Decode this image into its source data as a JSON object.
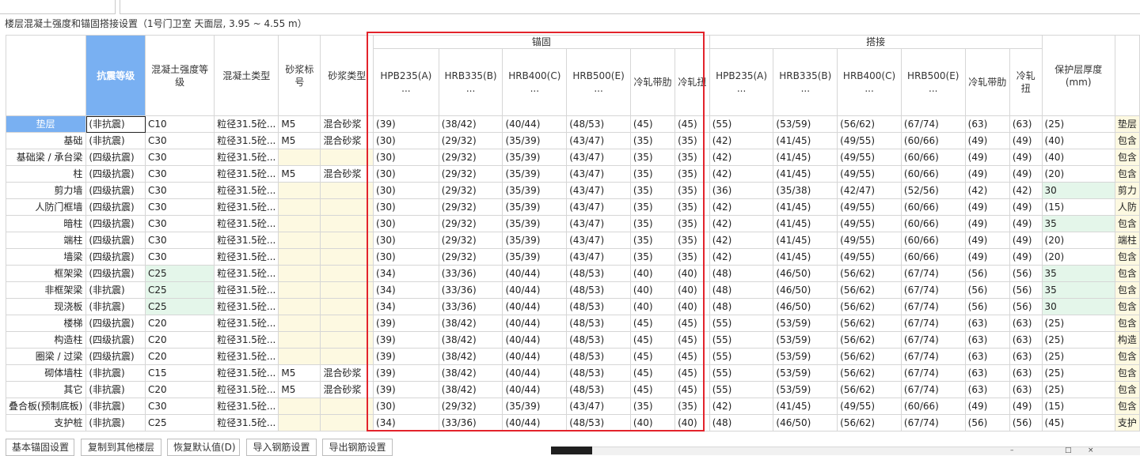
{
  "info_text": "楼层混凝土强度和锚固搭接设置（1号门卫室  天面层, 3.95 ~ 4.55 m）",
  "groups": {
    "anchor": "锚固",
    "lap": "搭接"
  },
  "headers": {
    "seismic": "抗震等级",
    "concrete_grade": "混凝土强度等级",
    "concrete_type": "混凝土类型",
    "mortar_grade": "砂浆标号",
    "mortar_type": "砂浆类型",
    "rebar": [
      "HPB235(A)",
      "HRB335(B)",
      "HRB400(C)",
      "HRB500(E)",
      "冷轧带肋",
      "冷轧扭"
    ],
    "rebar_dots": "...",
    "cover": "保护层厚度(mm)"
  },
  "rows": [
    {
      "name": "垫层",
      "seismic": "(非抗震)",
      "grade": "C10",
      "ctype": "粒径31.5砼...",
      "mgrade": "M5",
      "mtype": "混合砂浆",
      "anchor": [
        "(39)",
        "(38/42)",
        "(40/44)",
        "(48/53)",
        "(45)",
        "(45)"
      ],
      "lap": [
        "(55)",
        "(53/59)",
        "(56/62)",
        "(67/74)",
        "(63)",
        "(63)"
      ],
      "cover": "(25)",
      "note": "垫层"
    },
    {
      "name": "基础",
      "seismic": "(非抗震)",
      "grade": "C30",
      "ctype": "粒径31.5砼...",
      "mgrade": "M5",
      "mtype": "混合砂浆",
      "anchor": [
        "(30)",
        "(29/32)",
        "(35/39)",
        "(43/47)",
        "(35)",
        "(35)"
      ],
      "lap": [
        "(42)",
        "(41/45)",
        "(49/55)",
        "(60/66)",
        "(49)",
        "(49)"
      ],
      "cover": "(40)",
      "note": "包含"
    },
    {
      "name": "基础梁 / 承台梁",
      "seismic": "(四级抗震)",
      "grade": "C30",
      "ctype": "粒径31.5砼...",
      "mgrade": "",
      "mtype": "",
      "anchor": [
        "(30)",
        "(29/32)",
        "(35/39)",
        "(43/47)",
        "(35)",
        "(35)"
      ],
      "lap": [
        "(42)",
        "(41/45)",
        "(49/55)",
        "(60/66)",
        "(49)",
        "(49)"
      ],
      "cover": "(40)",
      "note": "包含"
    },
    {
      "name": "柱",
      "seismic": "(四级抗震)",
      "grade": "C30",
      "ctype": "粒径31.5砼...",
      "mgrade": "M5",
      "mtype": "混合砂浆",
      "anchor": [
        "(30)",
        "(29/32)",
        "(35/39)",
        "(43/47)",
        "(35)",
        "(35)"
      ],
      "lap": [
        "(42)",
        "(41/45)",
        "(49/55)",
        "(60/66)",
        "(49)",
        "(49)"
      ],
      "cover": "(20)",
      "note": "包含"
    },
    {
      "name": "剪力墙",
      "seismic": "(四级抗震)",
      "grade": "C30",
      "ctype": "粒径31.5砼...",
      "mgrade": "",
      "mtype": "",
      "anchor": [
        "(30)",
        "(29/32)",
        "(35/39)",
        "(43/47)",
        "(35)",
        "(35)"
      ],
      "lap": [
        "(36)",
        "(35/38)",
        "(42/47)",
        "(52/56)",
        "(42)",
        "(42)"
      ],
      "cover": "30",
      "note": "剪力"
    },
    {
      "name": "人防门框墙",
      "seismic": "(四级抗震)",
      "grade": "C30",
      "ctype": "粒径31.5砼...",
      "mgrade": "",
      "mtype": "",
      "anchor": [
        "(30)",
        "(29/32)",
        "(35/39)",
        "(43/47)",
        "(35)",
        "(35)"
      ],
      "lap": [
        "(42)",
        "(41/45)",
        "(49/55)",
        "(60/66)",
        "(49)",
        "(49)"
      ],
      "cover": "(15)",
      "note": "人防"
    },
    {
      "name": "暗柱",
      "seismic": "(四级抗震)",
      "grade": "C30",
      "ctype": "粒径31.5砼...",
      "mgrade": "",
      "mtype": "",
      "anchor": [
        "(30)",
        "(29/32)",
        "(35/39)",
        "(43/47)",
        "(35)",
        "(35)"
      ],
      "lap": [
        "(42)",
        "(41/45)",
        "(49/55)",
        "(60/66)",
        "(49)",
        "(49)"
      ],
      "cover": "35",
      "note": "包含"
    },
    {
      "name": "端柱",
      "seismic": "(四级抗震)",
      "grade": "C30",
      "ctype": "粒径31.5砼...",
      "mgrade": "",
      "mtype": "",
      "anchor": [
        "(30)",
        "(29/32)",
        "(35/39)",
        "(43/47)",
        "(35)",
        "(35)"
      ],
      "lap": [
        "(42)",
        "(41/45)",
        "(49/55)",
        "(60/66)",
        "(49)",
        "(49)"
      ],
      "cover": "(20)",
      "note": "端柱"
    },
    {
      "name": "墙梁",
      "seismic": "(四级抗震)",
      "grade": "C30",
      "ctype": "粒径31.5砼...",
      "mgrade": "",
      "mtype": "",
      "anchor": [
        "(30)",
        "(29/32)",
        "(35/39)",
        "(43/47)",
        "(35)",
        "(35)"
      ],
      "lap": [
        "(42)",
        "(41/45)",
        "(49/55)",
        "(60/66)",
        "(49)",
        "(49)"
      ],
      "cover": "(20)",
      "note": "包含"
    },
    {
      "name": "框架梁",
      "seismic": "(四级抗震)",
      "grade": "C25",
      "ctype": "粒径31.5砼...",
      "mgrade": "",
      "mtype": "",
      "anchor": [
        "(34)",
        "(33/36)",
        "(40/44)",
        "(48/53)",
        "(40)",
        "(40)"
      ],
      "lap": [
        "(48)",
        "(46/50)",
        "(56/62)",
        "(67/74)",
        "(56)",
        "(56)"
      ],
      "cover": "35",
      "note": "包含"
    },
    {
      "name": "非框架梁",
      "seismic": "(非抗震)",
      "grade": "C25",
      "ctype": "粒径31.5砼...",
      "mgrade": "",
      "mtype": "",
      "anchor": [
        "(34)",
        "(33/36)",
        "(40/44)",
        "(48/53)",
        "(40)",
        "(40)"
      ],
      "lap": [
        "(48)",
        "(46/50)",
        "(56/62)",
        "(67/74)",
        "(56)",
        "(56)"
      ],
      "cover": "35",
      "note": "包含"
    },
    {
      "name": "现浇板",
      "seismic": "(非抗震)",
      "grade": "C25",
      "ctype": "粒径31.5砼...",
      "mgrade": "",
      "mtype": "",
      "anchor": [
        "(34)",
        "(33/36)",
        "(40/44)",
        "(48/53)",
        "(40)",
        "(40)"
      ],
      "lap": [
        "(48)",
        "(46/50)",
        "(56/62)",
        "(67/74)",
        "(56)",
        "(56)"
      ],
      "cover": "30",
      "note": "包含"
    },
    {
      "name": "楼梯",
      "seismic": "(四级抗震)",
      "grade": "C20",
      "ctype": "粒径31.5砼...",
      "mgrade": "",
      "mtype": "",
      "anchor": [
        "(39)",
        "(38/42)",
        "(40/44)",
        "(48/53)",
        "(45)",
        "(45)"
      ],
      "lap": [
        "(55)",
        "(53/59)",
        "(56/62)",
        "(67/74)",
        "(63)",
        "(63)"
      ],
      "cover": "(25)",
      "note": "包含"
    },
    {
      "name": "构造柱",
      "seismic": "(四级抗震)",
      "grade": "C20",
      "ctype": "粒径31.5砼...",
      "mgrade": "",
      "mtype": "",
      "anchor": [
        "(39)",
        "(38/42)",
        "(40/44)",
        "(48/53)",
        "(45)",
        "(45)"
      ],
      "lap": [
        "(55)",
        "(53/59)",
        "(56/62)",
        "(67/74)",
        "(63)",
        "(63)"
      ],
      "cover": "(25)",
      "note": "构造"
    },
    {
      "name": "圈梁 / 过梁",
      "seismic": "(四级抗震)",
      "grade": "C20",
      "ctype": "粒径31.5砼...",
      "mgrade": "",
      "mtype": "",
      "anchor": [
        "(39)",
        "(38/42)",
        "(40/44)",
        "(48/53)",
        "(45)",
        "(45)"
      ],
      "lap": [
        "(55)",
        "(53/59)",
        "(56/62)",
        "(67/74)",
        "(63)",
        "(63)"
      ],
      "cover": "(25)",
      "note": "包含"
    },
    {
      "name": "砌体墙柱",
      "seismic": "(非抗震)",
      "grade": "C15",
      "ctype": "粒径31.5砼...",
      "mgrade": "M5",
      "mtype": "混合砂浆",
      "anchor": [
        "(39)",
        "(38/42)",
        "(40/44)",
        "(48/53)",
        "(45)",
        "(45)"
      ],
      "lap": [
        "(55)",
        "(53/59)",
        "(56/62)",
        "(67/74)",
        "(63)",
        "(63)"
      ],
      "cover": "(25)",
      "note": "包含"
    },
    {
      "name": "其它",
      "seismic": "(非抗震)",
      "grade": "C20",
      "ctype": "粒径31.5砼...",
      "mgrade": "M5",
      "mtype": "混合砂浆",
      "anchor": [
        "(39)",
        "(38/42)",
        "(40/44)",
        "(48/53)",
        "(45)",
        "(45)"
      ],
      "lap": [
        "(55)",
        "(53/59)",
        "(56/62)",
        "(67/74)",
        "(63)",
        "(63)"
      ],
      "cover": "(25)",
      "note": "包含"
    },
    {
      "name": "叠合板(预制底板)",
      "seismic": "(非抗震)",
      "grade": "C30",
      "ctype": "粒径31.5砼...",
      "mgrade": "",
      "mtype": "",
      "anchor": [
        "(30)",
        "(29/32)",
        "(35/39)",
        "(43/47)",
        "(35)",
        "(35)"
      ],
      "lap": [
        "(42)",
        "(41/45)",
        "(49/55)",
        "(60/66)",
        "(49)",
        "(49)"
      ],
      "cover": "(15)",
      "note": "包含"
    },
    {
      "name": "支护桩",
      "seismic": "(非抗震)",
      "grade": "C25",
      "ctype": "粒径31.5砼...",
      "mgrade": "",
      "mtype": "",
      "anchor": [
        "(34)",
        "(33/36)",
        "(40/44)",
        "(48/53)",
        "(40)",
        "(40)"
      ],
      "lap": [
        "(48)",
        "(46/50)",
        "(56/62)",
        "(67/74)",
        "(56)",
        "(56)"
      ],
      "cover": "(45)",
      "note": "支护"
    }
  ],
  "buttons": [
    "基本锚固设置",
    "复制到其他楼层",
    "恢复默认值(D)",
    "导入钢筋设置",
    "导出钢筋设置"
  ],
  "colors": {
    "selection": "#79b0f2",
    "highlight_box": "#e3232b",
    "empty_cell": "#fdf9e1",
    "modified_cell": "#e4f6ea"
  }
}
